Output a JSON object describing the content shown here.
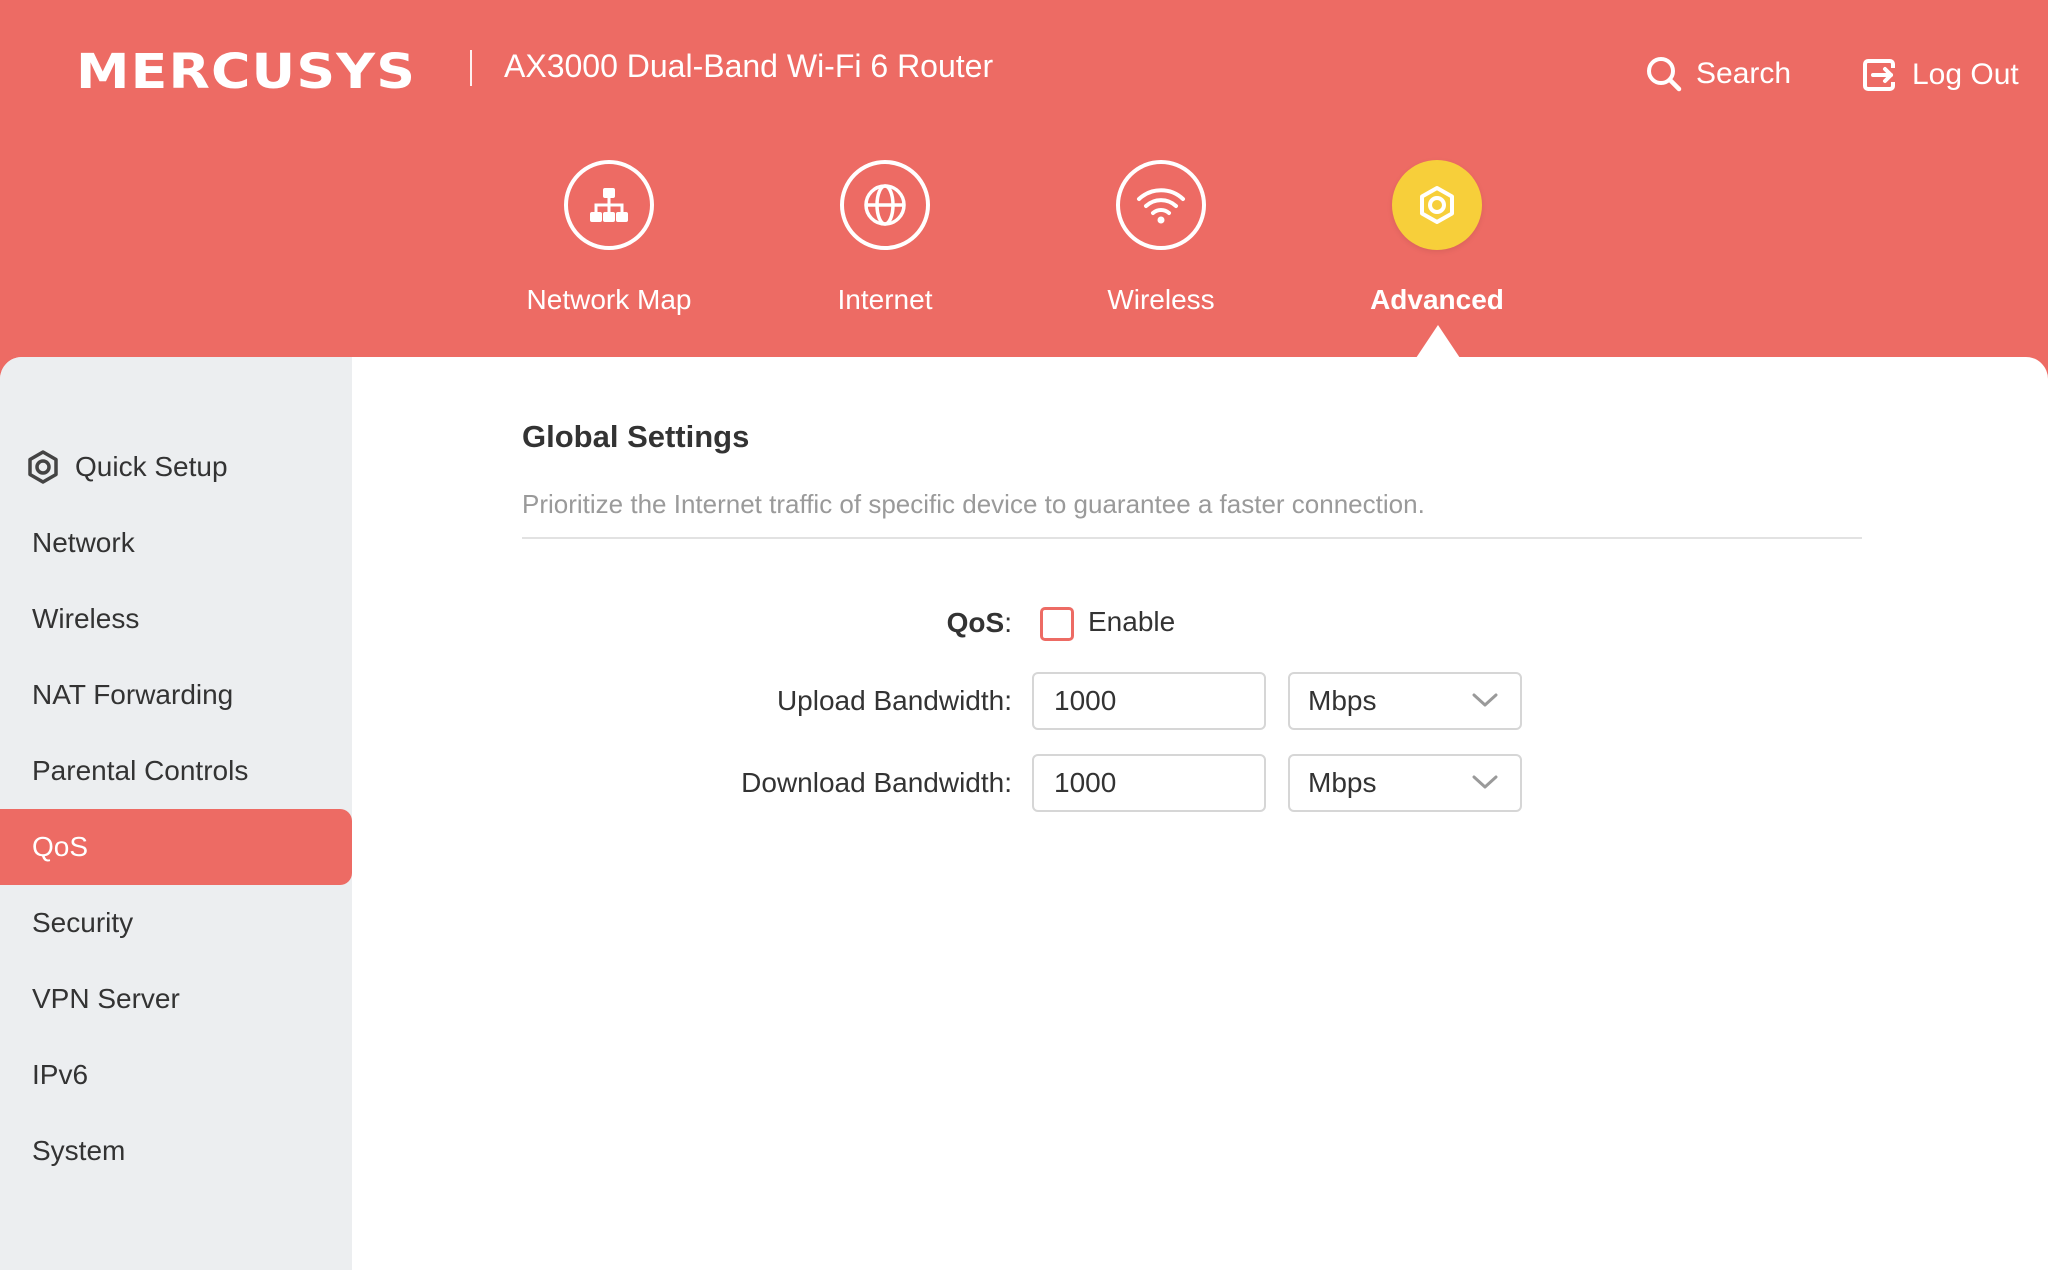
{
  "brand": {
    "logo_text": "MERCUSYS",
    "product_name": "AX3000 Dual-Band Wi-Fi 6 Router",
    "accent": "#ed6b64",
    "highlight": "#f7cf3a"
  },
  "header": {
    "search_label": "Search",
    "logout_label": "Log Out",
    "separator": "|"
  },
  "nav": {
    "items": [
      {
        "label": "Network Map",
        "icon": "network-map-icon",
        "active": false
      },
      {
        "label": "Internet",
        "icon": "globe-icon",
        "active": false
      },
      {
        "label": "Wireless",
        "icon": "wifi-icon",
        "active": false
      },
      {
        "label": "Advanced",
        "icon": "gear-icon",
        "active": true
      }
    ]
  },
  "sidebar": {
    "items": [
      {
        "label": "Quick Setup",
        "icon": "gear-icon"
      },
      {
        "label": "Network"
      },
      {
        "label": "Wireless"
      },
      {
        "label": "NAT Forwarding"
      },
      {
        "label": "Parental Controls"
      },
      {
        "label": "QoS",
        "active": true
      },
      {
        "label": "Security"
      },
      {
        "label": "VPN Server"
      },
      {
        "label": "IPv6"
      },
      {
        "label": "System"
      }
    ]
  },
  "main": {
    "title": "Global Settings",
    "description": "Prioritize the Internet traffic of specific device to guarantee a faster connection.",
    "qos": {
      "label": "QoS",
      "colon": ":",
      "checkbox_label": "Enable",
      "checked": false
    },
    "upload": {
      "label": "Upload Bandwidth:",
      "value": "1000",
      "unit": "Mbps"
    },
    "download": {
      "label": "Download Bandwidth:",
      "value": "1000",
      "unit": "Mbps"
    }
  }
}
